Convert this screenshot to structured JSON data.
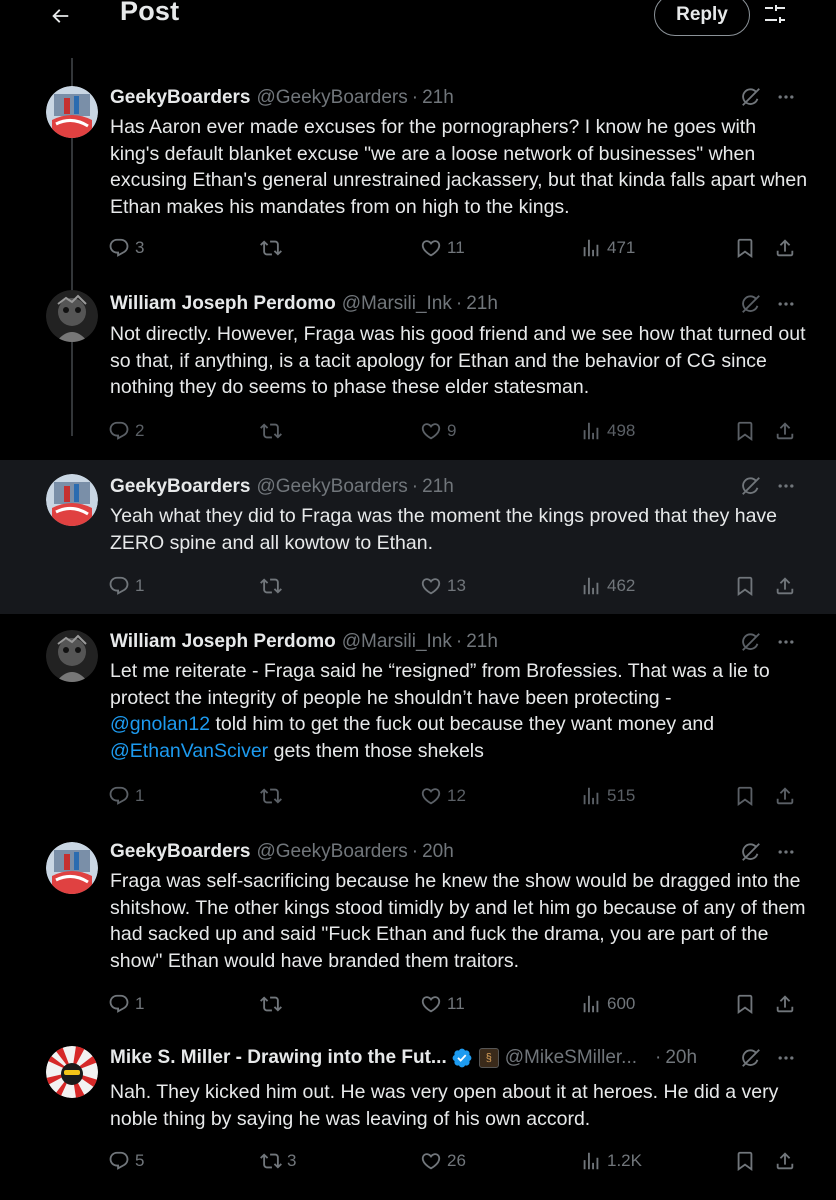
{
  "header": {
    "title": "Post",
    "reply_label": "Reply"
  },
  "icons": {
    "back": "arrow-left-icon",
    "tune": "sliders-icon",
    "grok": "grok-icon",
    "more": "more-icon",
    "reply": "reply-icon",
    "retweet": "retweet-icon",
    "like": "heart-icon",
    "views": "views-icon",
    "bookmark": "bookmark-icon",
    "share": "share-icon"
  },
  "colors": {
    "background": "#000000",
    "highlight": "#16181c",
    "text": "#e7e9ea",
    "muted": "#71767b",
    "link": "#1d9bf0",
    "verified": "#1d9bf0"
  },
  "tweets": [
    {
      "name": "GeekyBoarders",
      "handle": "@GeekyBoarders",
      "time": "21h",
      "text": "Has Aaron ever made excuses for the pornographers? I know he goes with king's default blanket excuse \"we are a loose network of businesses\" when excusing Ethan's general unrestrained jackassery, but that kinda falls apart when Ethan makes his mandates from on high to the kings.",
      "replies": "3",
      "retweets": "",
      "likes": "11",
      "views": "471"
    },
    {
      "name": "William Joseph Perdomo",
      "handle": "@Marsili_Ink",
      "time": "21h",
      "text": "Not directly. However, Fraga was his good friend and we see how that turned out so that, if anything, is a tacit apology for Ethan and the behavior of CG since nothing they do seems to phase these elder statesman.",
      "replies": "2",
      "retweets": "",
      "likes": "9",
      "views": "498"
    },
    {
      "name": "GeekyBoarders",
      "handle": "@GeekyBoarders",
      "time": "21h",
      "text": "Yeah what they did to Fraga was the moment the kings proved that they have ZERO spine and all kowtow to Ethan.",
      "replies": "1",
      "retweets": "",
      "likes": "13",
      "views": "462"
    },
    {
      "name": "William Joseph Perdomo",
      "handle": "@Marsili_Ink",
      "time": "21h",
      "text_part1": "Let me reiterate - Fraga said he “resigned” from Brofessies. That was a lie to protect the integrity of people he shouldn’t have been protecting -",
      "mention1": "@gnolan12",
      "text_part2": " told him to get the fuck out because they want money and",
      "mention2": "@EthanVanSciver",
      "text_part3": " gets them those shekels",
      "replies": "1",
      "retweets": "",
      "likes": "12",
      "views": "515"
    },
    {
      "name": "GeekyBoarders",
      "handle": "@GeekyBoarders",
      "time": "20h",
      "text": "Fraga was self-sacrificing because he knew the show would be dragged into the shitshow. The other kings stood timidly by and let him go because of any of them had sacked up and said \"Fuck Ethan and fuck the drama, you are part of the show\" Ethan would have branded them traitors.",
      "replies": "1",
      "retweets": "",
      "likes": "11",
      "views": "600"
    },
    {
      "name": "Mike S. Miller - Drawing into the Fut...",
      "handle": "@MikeSMiller...",
      "time": "20h",
      "text": "Nah. They kicked him out. He was very open about it at heroes. He did a very noble thing by saying he was leaving of his own accord.",
      "replies": "5",
      "retweets": "3",
      "likes": "26",
      "views": "1.2K"
    }
  ]
}
